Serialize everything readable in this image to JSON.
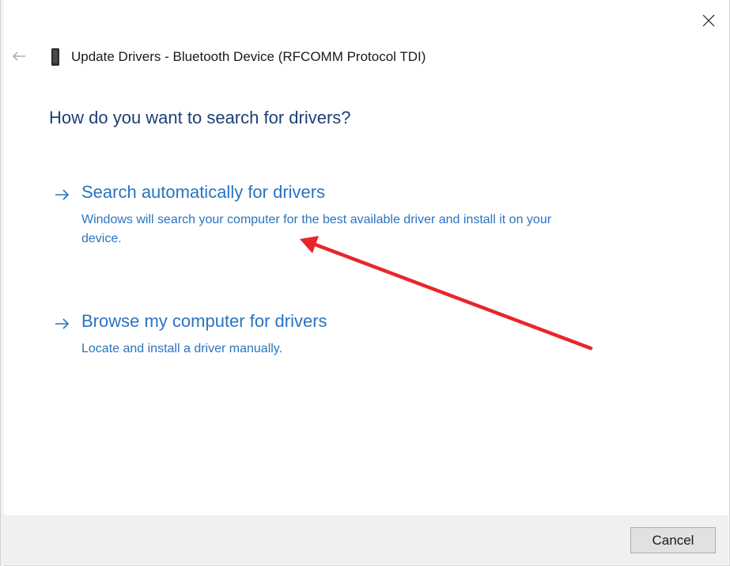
{
  "window": {
    "title": "Update Drivers - Bluetooth Device (RFCOMM Protocol TDI)",
    "close_icon": "close-icon",
    "back_icon": "back-arrow-icon",
    "device_icon": "device-icon"
  },
  "main": {
    "heading": "How do you want to search for drivers?",
    "options": [
      {
        "title": "Search automatically for drivers",
        "description": "Windows will search your computer for the best available driver and install it on your device.",
        "icon": "arrow-right-icon"
      },
      {
        "title": "Browse my computer for drivers",
        "description": "Locate and install a driver manually.",
        "icon": "arrow-right-icon"
      }
    ]
  },
  "footer": {
    "cancel_label": "Cancel"
  },
  "annotation": {
    "type": "red-arrow",
    "color": "#e8262a",
    "points_to": "Search automatically for drivers"
  },
  "colors": {
    "heading": "#1e3f73",
    "link": "#2a74c1",
    "footer_bg": "#f0f0f0"
  }
}
